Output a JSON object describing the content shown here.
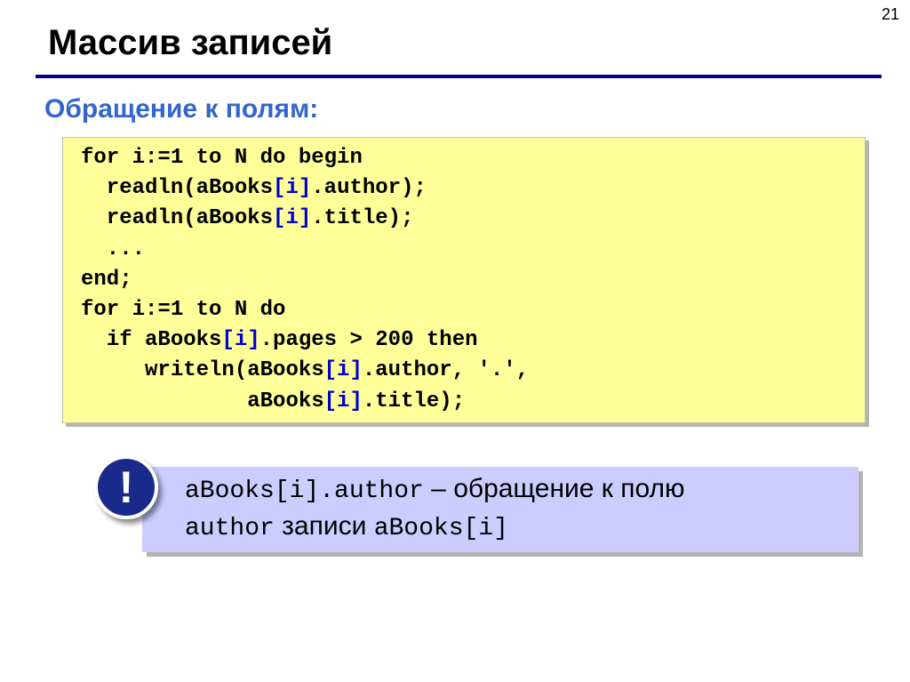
{
  "slide": {
    "page_number": "21",
    "title": "Массив записей",
    "subtitle": "Обращение к полям:"
  },
  "code": {
    "lines": [
      [
        {
          "t": "for i:=1 to N do begin"
        }
      ],
      [
        {
          "t": "  readln(aBooks"
        },
        {
          "t": "[i]",
          "c": "idx"
        },
        {
          "t": ".author);"
        }
      ],
      [
        {
          "t": "  readln(aBooks"
        },
        {
          "t": "[i]",
          "c": "idx"
        },
        {
          "t": ".title);"
        }
      ],
      [
        {
          "t": "  ..."
        }
      ],
      [
        {
          "t": "end;"
        }
      ],
      [
        {
          "t": "for i:=1 to N do"
        }
      ],
      [
        {
          "t": "  if aBooks"
        },
        {
          "t": "[i]",
          "c": "idx"
        },
        {
          "t": ".pages > 200 then"
        }
      ],
      [
        {
          "t": "     writeln(aBooks"
        },
        {
          "t": "[i]",
          "c": "idx"
        },
        {
          "t": ".author, '.',"
        }
      ],
      [
        {
          "t": "             aBooks"
        },
        {
          "t": "[i]",
          "c": "idx"
        },
        {
          "t": ".title);"
        }
      ]
    ]
  },
  "note": {
    "icon": "exclamation-icon",
    "icon_glyph": "!",
    "line1_code": "aBooks[i].author",
    "line1_text": " – обращение к полю",
    "line2_code1": "author",
    "line2_text": " записи ",
    "line2_code2": "aBooks[i]"
  }
}
